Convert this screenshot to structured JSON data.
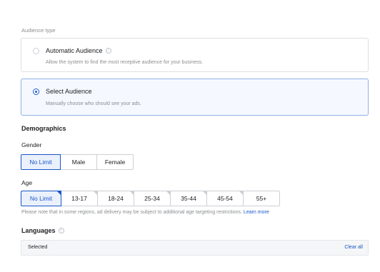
{
  "audience_type": {
    "label": "Audience type",
    "options": [
      {
        "title": "Automatic Audience",
        "description": "Allow the system to find the most receptive audience for your business.",
        "selected": false
      },
      {
        "title": "Select Audience",
        "description": "Manually choose who should see your ads.",
        "selected": true
      }
    ]
  },
  "demographics": {
    "heading": "Demographics",
    "gender": {
      "label": "Gender",
      "options": [
        "No Limit",
        "Male",
        "Female"
      ],
      "selected": "No Limit"
    },
    "age": {
      "label": "Age",
      "options": [
        "No Limit",
        "13-17",
        "18-24",
        "25-34",
        "35-44",
        "45-54",
        "55+"
      ],
      "selected": "No Limit",
      "note": "Please note that in some regions, ad delivery may be subject to additional age targeting restrictions.",
      "note_link": "Learn more"
    }
  },
  "languages": {
    "heading": "Languages",
    "selected_label": "Selected",
    "clear_all": "Clear all"
  },
  "colors": {
    "accent": "#1a56c7",
    "selected_card_border": "#8fb0e6",
    "muted_text": "#8a8d91"
  }
}
